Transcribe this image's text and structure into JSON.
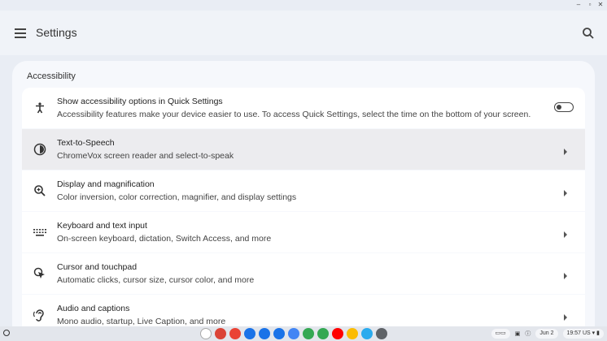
{
  "app": {
    "title": "Settings"
  },
  "section": {
    "title": "Accessibility"
  },
  "rows": [
    {
      "icon": "accessibility-icon",
      "title": "Show accessibility options in Quick Settings",
      "subtitle": "Accessibility features make your device easier to use. To access Quick Settings, select the time on the bottom of your screen.",
      "control": "toggle",
      "toggle_on": false
    },
    {
      "icon": "text-to-speech-icon",
      "title": "Text-to-Speech",
      "subtitle": "ChromeVox screen reader and select-to-speak",
      "control": "chevron"
    },
    {
      "icon": "magnifier-icon",
      "title": "Display and magnification",
      "subtitle": "Color inversion, color correction, magnifier, and display settings",
      "control": "chevron"
    },
    {
      "icon": "keyboard-icon",
      "title": "Keyboard and text input",
      "subtitle": "On-screen keyboard, dictation, Switch Access, and more",
      "control": "chevron"
    },
    {
      "icon": "cursor-icon",
      "title": "Cursor and touchpad",
      "subtitle": "Automatic clicks, cursor size, cursor color, and more",
      "control": "chevron"
    },
    {
      "icon": "audio-captions-icon",
      "title": "Audio and captions",
      "subtitle": "Mono audio, startup, Live Caption, and more",
      "control": "chevron"
    }
  ],
  "shelf": {
    "apps": [
      {
        "name": "add-icon",
        "color": "#ffffff"
      },
      {
        "name": "chrome-icon",
        "color": "#db4437"
      },
      {
        "name": "gmail-icon",
        "color": "#ea4335"
      },
      {
        "name": "calendar-icon",
        "color": "#1a73e8"
      },
      {
        "name": "files-icon",
        "color": "#1a73e8"
      },
      {
        "name": "messages-icon",
        "color": "#1a73e8"
      },
      {
        "name": "docs-icon",
        "color": "#4285f4"
      },
      {
        "name": "meet-icon",
        "color": "#34a853"
      },
      {
        "name": "play-store-icon",
        "color": "#34a853"
      },
      {
        "name": "youtube-icon",
        "color": "#ff0000"
      },
      {
        "name": "photos-icon",
        "color": "#fbbc04"
      },
      {
        "name": "telegram-icon",
        "color": "#2aabee"
      },
      {
        "name": "settings-icon",
        "color": "#5f6368"
      }
    ],
    "date": "Jun 2",
    "time": "19:57",
    "locale": "US"
  }
}
